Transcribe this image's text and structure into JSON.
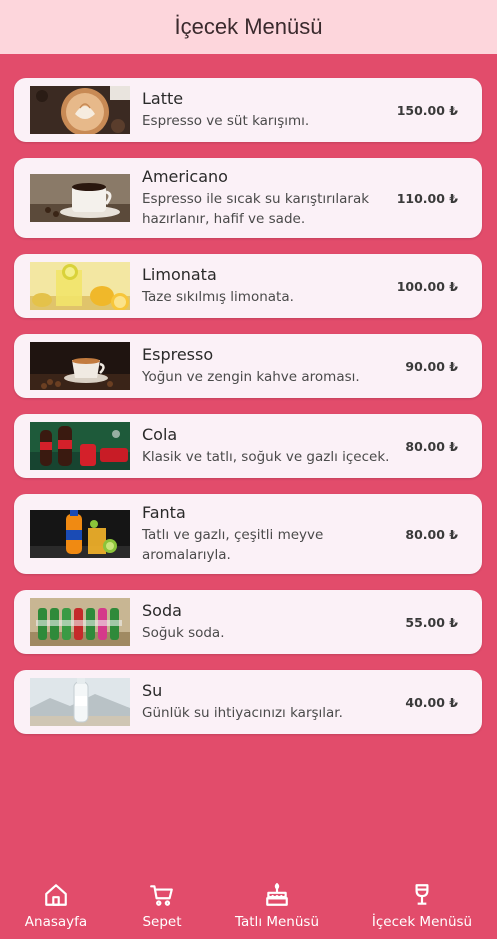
{
  "app": {
    "title": "İçecek Menüsü"
  },
  "items": [
    {
      "name": "Latte",
      "description": "Espresso ve süt karışımı.",
      "price": "150.00 ₺",
      "image_icon": "latte-art-photo"
    },
    {
      "name": "Americano",
      "description": "Espresso ile sıcak su karıştırılarak hazırlanır, hafif ve sade.",
      "price": "110.00 ₺",
      "image_icon": "coffee-cup-photo"
    },
    {
      "name": "Limonata",
      "description": "Taze sıkılmış limonata.",
      "price": "100.00 ₺",
      "image_icon": "lemonade-photo"
    },
    {
      "name": "Espresso",
      "description": "Yoğun ve zengin kahve aroması.",
      "price": "90.00 ₺",
      "image_icon": "espresso-photo"
    },
    {
      "name": "Cola",
      "description": "Klasik ve tatlı, soğuk ve gazlı içecek.",
      "price": "80.00 ₺",
      "image_icon": "cola-photo"
    },
    {
      "name": "Fanta",
      "description": "Tatlı ve gazlı, çeşitli meyve aromalarıyla.",
      "price": "80.00 ₺",
      "image_icon": "fanta-photo"
    },
    {
      "name": "Soda",
      "description": "Soğuk soda.",
      "price": "55.00 ₺",
      "image_icon": "soda-bottles-photo"
    },
    {
      "name": "Su",
      "description": "Günlük su ihtiyacınızı karşılar.",
      "price": "40.00 ₺",
      "image_icon": "water-bottle-photo"
    }
  ],
  "nav": [
    {
      "label": "Anasayfa",
      "icon": "home-icon"
    },
    {
      "label": "Sepet",
      "icon": "cart-icon"
    },
    {
      "label": "Tatlı Menüsü",
      "icon": "cake-icon"
    },
    {
      "label": "İçecek Menüsü",
      "icon": "drink-icon"
    }
  ],
  "colors": {
    "background": "#e24c6b",
    "appbar": "#fdd6dc",
    "card": "#fbf1f7"
  }
}
